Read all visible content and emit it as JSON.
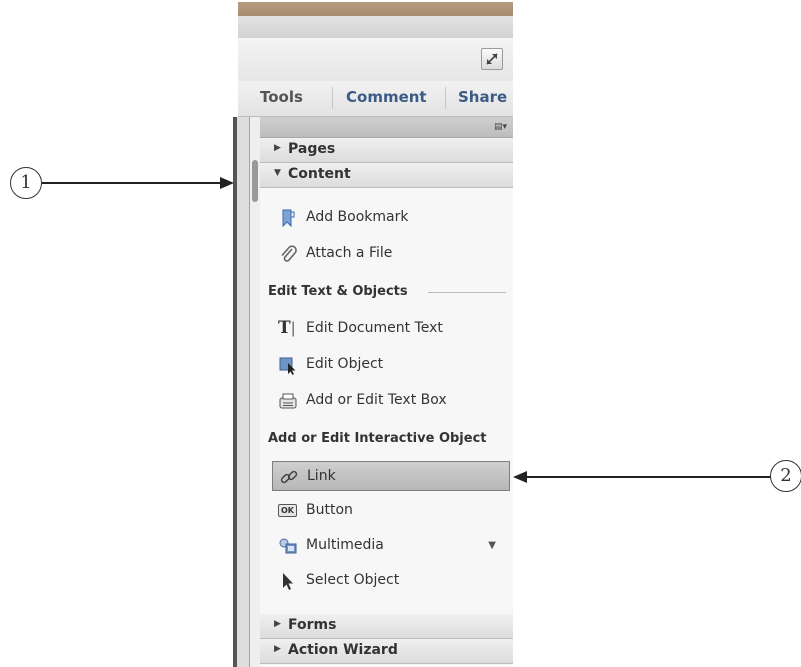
{
  "tabs": {
    "tools": "Tools",
    "comment": "Comment",
    "share": "Share"
  },
  "sections": {
    "pages": "Pages",
    "content": "Content",
    "forms": "Forms",
    "action_wizard": "Action Wizard"
  },
  "content_items": {
    "add_bookmark": "Add Bookmark",
    "attach_file": "Attach a File"
  },
  "groups": {
    "edit_text_objects": "Edit Text & Objects",
    "add_edit_interactive": "Add or Edit Interactive Object"
  },
  "edit_items": {
    "edit_document_text": "Edit Document Text",
    "edit_object": "Edit Object",
    "add_edit_text_box": "Add or Edit Text Box"
  },
  "interactive_items": {
    "link": "Link",
    "button": "Button",
    "multimedia": "Multimedia",
    "select_object": "Select Object"
  },
  "icon_glyphs": {
    "text_tool": "T",
    "ok_badge": "OK"
  },
  "annotations": {
    "callout_1": "1",
    "callout_2": "2"
  },
  "colors": {
    "tab_accent": "#3c5b86",
    "selected_bg": "#c4c4c4"
  }
}
